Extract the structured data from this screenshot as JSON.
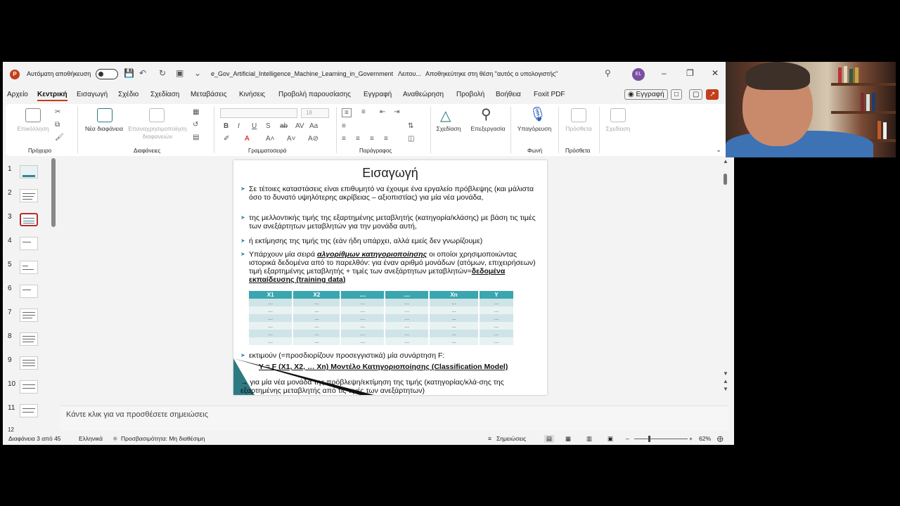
{
  "titlebar": {
    "autosave_label": "Αυτόματη αποθήκευση",
    "filename": "e_Gov_Artificial_Intelligence_Machine_Learning_in_Government",
    "mode": "Λειτου...",
    "save_status": "Αποθηκεύτηκε στη θέση \"αυτός ο υπολογιστής\"",
    "user_initials": "EL"
  },
  "menu": {
    "items": [
      "Αρχείο",
      "Κεντρική",
      "Εισαγωγή",
      "Σχέδιο",
      "Σχεδίαση",
      "Μεταβάσεις",
      "Κινήσεις",
      "Προβολή παρουσίασης",
      "Εγγραφή",
      "Αναθεώρηση",
      "Προβολή",
      "Βοήθεια",
      "Foxit PDF"
    ],
    "record_button": "Εγγραφή"
  },
  "ribbon": {
    "paste": "Επικόλληση",
    "new_slide": "Νέα διαφάνεια",
    "reuse_slides": "Επαναχρησιμοποίηση διαφανειών",
    "font_size": "18",
    "drawing": "Σχεδίαση",
    "editing": "Επεξεργασία",
    "dictate": "Υπαγόρευση",
    "addins": "Πρόσθετα",
    "designer": "Σχεδίαση",
    "groups": {
      "clipboard": "Πρόχειρο",
      "slides": "Διαφάνειες",
      "font": "Γραμματοσειρά",
      "paragraph": "Παράγραφος",
      "voice": "Φωνή",
      "addins": "Πρόσθετα"
    }
  },
  "thumbnails": [
    "1",
    "2",
    "3",
    "4",
    "5",
    "6",
    "7",
    "8",
    "9",
    "10",
    "11",
    "12"
  ],
  "slide": {
    "title": "Εισαγωγή",
    "b1": "Σε τέτοιες καταστάσεις είναι επιθυμητό να έχουμε ένα εργαλείο πρόβλεψης (και μάλιστα όσο το δυνατό υψηλότερης ακρίβειας – αξιοπιστίας) για μία νέα μονάδα,",
    "b2": "της μελλοντικής τιμής της εξαρτημένης μεταβλητής (κατηγορία/κλάσης) με βάση τις τιμές των ανεξάρτητων μεταβλητών για την μονάδα αυτή,",
    "b3": "ή εκτίμησης της τιμής της (εάν ήδη υπάρχει, αλλά εμείς δεν γνωρίζουμε)",
    "b4_pre": "Υπάρχουν μία σειρά ",
    "b4_ul1": "αλγορίθμων κατηγοριοποίησης",
    "b4_mid": " οι οποίοι χρησιμοποιώντας ιστορικά δεδομένα από το παρελθόν: για έναν αριθμό μονάδων (ατόμων, επιχειρήσεων) τιμή εξαρτημένης μεταβλητής + τιμές των ανεξάρτητων μεταβλητών=",
    "b4_ul2": "δεδομένα εκπαίδευσης (training data)",
    "table_headers": [
      "X1",
      "X2",
      "....",
      "....",
      "Xn",
      "Y"
    ],
    "table_cell": "...",
    "b5": "εκτιμούν (=προσδιορίζουν προσεγγιστικά) μία συνάρτηση F:",
    "model": "Y = F (X1, X2, … Xn)  Μοντέλο Κατηγοριοποίησης (Classification Model)",
    "b6": "→ για μία νέα μονάδα της πρόβλεψη/εκτίμηση της τιμής (κατηγορίας/κλά-σης της εξαρτημένης μεταβλητής από τις τιμές των ανεξάρτητων)"
  },
  "notes_placeholder": "Κάντε κλικ για να προσθέσετε σημειώσεις",
  "status": {
    "slide_count": "Διαφάνεια 3 από 45",
    "language": "Ελληνικά",
    "accessibility": "Προσβασιμότητα: Μη διαθέσιμη",
    "notes": "Σημειώσεις",
    "zoom": "62%"
  },
  "colors": {
    "accent": "#c43e1c",
    "table_header": "#3aa6b0"
  }
}
